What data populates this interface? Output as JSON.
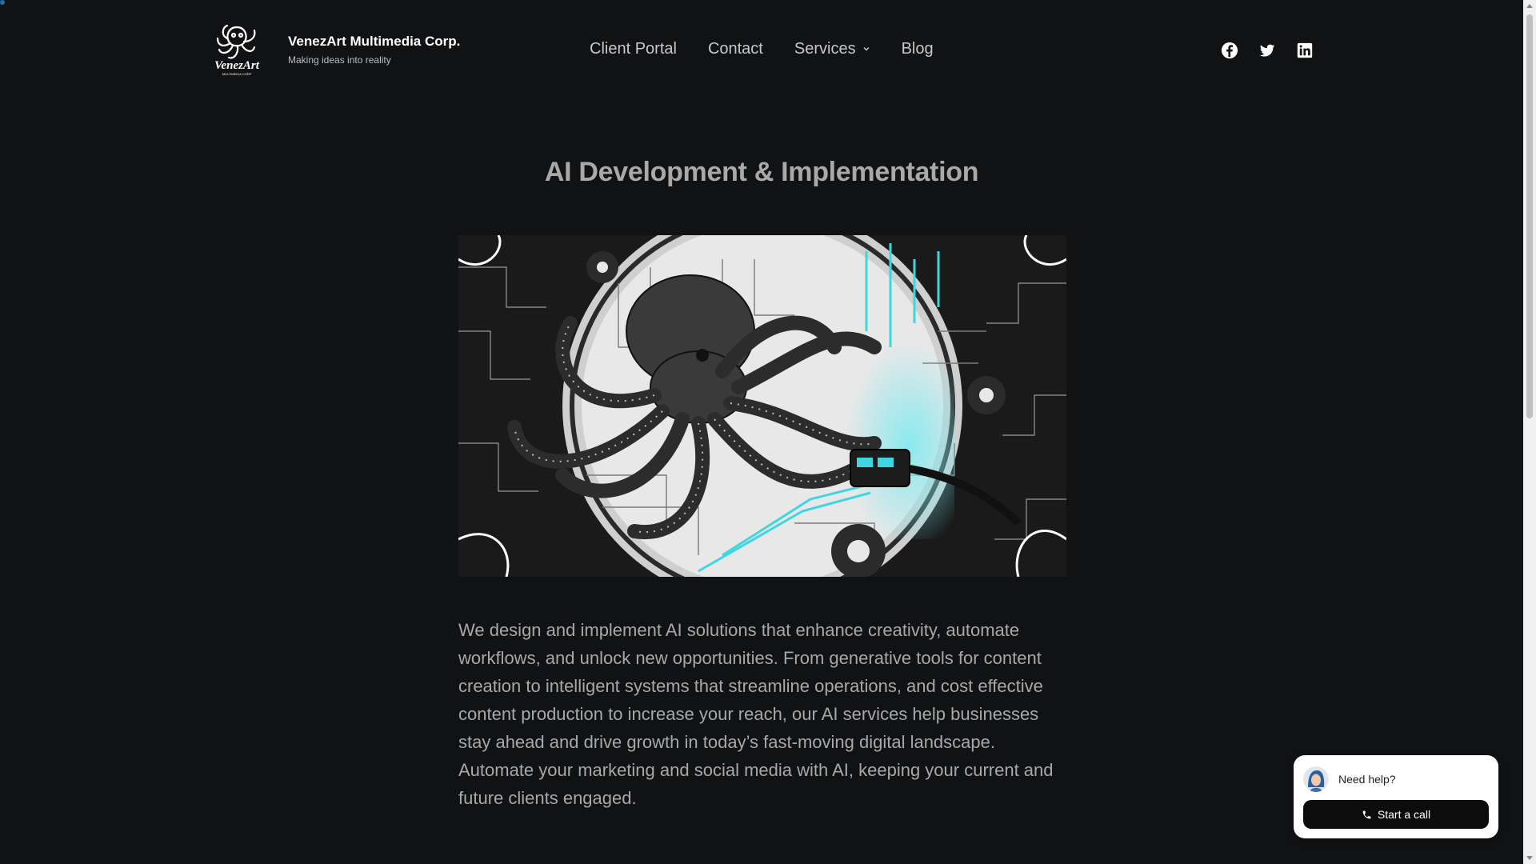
{
  "site": {
    "title": "VenezArt Multimedia Corp.",
    "tagline": "Making ideas into reality",
    "logo_icon": "octopus-logo-icon"
  },
  "nav": {
    "items": [
      {
        "label": "Client Portal"
      },
      {
        "label": "Contact"
      },
      {
        "label": "Services",
        "has_dropdown": true
      },
      {
        "label": "Blog"
      }
    ]
  },
  "social": {
    "icons": [
      "facebook-icon",
      "twitter-icon",
      "linkedin-icon"
    ]
  },
  "main": {
    "title": "AI Development & Implementation",
    "hero_image": "octopus-circuit-board-illustration",
    "body": "We design and implement AI solutions that enhance creativity, automate workflows, and unlock new opportunities. From generative tools for content creation to intelligent systems that streamline operations, and cost effective content production to increase your reach, our AI services help businesses stay ahead and drive growth in today’s fast-moving digital landscape. Automate your marketing and social media with AI, keeping your current and future clients engaged."
  },
  "help_widget": {
    "prompt": "Need help?",
    "button_label": "Start a call",
    "button_icon": "phone-icon"
  },
  "colors": {
    "background": "#111214",
    "accent_cyan": "#3fd6e0",
    "widget_bg": "#ffffff",
    "button_bg": "#0c0c0c"
  }
}
